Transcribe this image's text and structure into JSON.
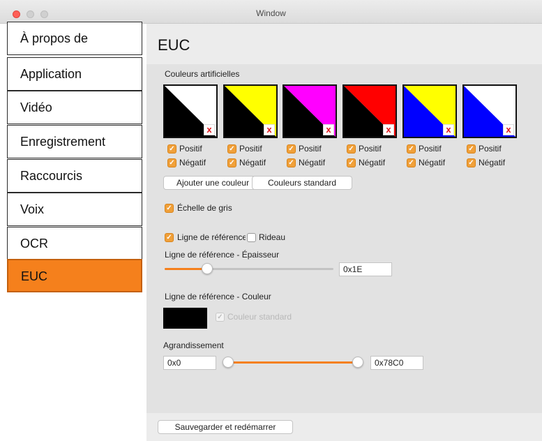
{
  "window": {
    "title": "Window"
  },
  "sidebar": {
    "items": [
      {
        "label": "À propos de"
      },
      {
        "label": "Application"
      },
      {
        "label": "Vidéo"
      },
      {
        "label": "Enregistrement"
      },
      {
        "label": "Raccourcis"
      },
      {
        "label": "Voix"
      },
      {
        "label": "OCR"
      },
      {
        "label": "EUC",
        "active": true
      }
    ]
  },
  "main": {
    "title": "EUC",
    "artificial_colors": {
      "label": "Couleurs artificielles",
      "remove_glyph": "x",
      "positive_label": "Positif",
      "negative_label": "Négatif",
      "swatches": [
        {
          "positive": "#ffffff",
          "negative": "#000000",
          "positive_checked": true,
          "negative_checked": true
        },
        {
          "positive": "#ffff00",
          "negative": "#000000",
          "positive_checked": true,
          "negative_checked": true
        },
        {
          "positive": "#ff00ff",
          "negative": "#000000",
          "positive_checked": true,
          "negative_checked": true
        },
        {
          "positive": "#ff0000",
          "negative": "#000000",
          "positive_checked": true,
          "negative_checked": true
        },
        {
          "positive": "#ffff00",
          "negative": "#0000ff",
          "positive_checked": true,
          "negative_checked": true
        },
        {
          "positive": "#ffffff",
          "negative": "#0000ff",
          "positive_checked": true,
          "negative_checked": true
        }
      ],
      "add_button": "Ajouter une couleur",
      "standard_button": "Couleurs standard"
    },
    "grayscale": {
      "label": "Échelle de gris",
      "checked": true
    },
    "reference_line": {
      "label": "Ligne de référence",
      "checked": true
    },
    "curtain": {
      "label": "Rideau",
      "checked": false
    },
    "thickness": {
      "label": "Ligne de référence - Épaisseur",
      "value": "0x1E",
      "fraction": 0.25
    },
    "line_color": {
      "label": "Ligne de référence - Couleur",
      "color": "#000000",
      "standard_label": "Couleur standard",
      "standard_checked": true,
      "standard_disabled": true
    },
    "magnification": {
      "label": "Agrandissement",
      "min_value": "0x0",
      "max_value": "0x78C0",
      "range": [
        0.0,
        1.0
      ]
    },
    "save_button": "Sauvegarder et redémarrer"
  },
  "colors": {
    "accent": "#f5801c",
    "checkbox": "#f0a03a",
    "remove": "#e0161b"
  }
}
